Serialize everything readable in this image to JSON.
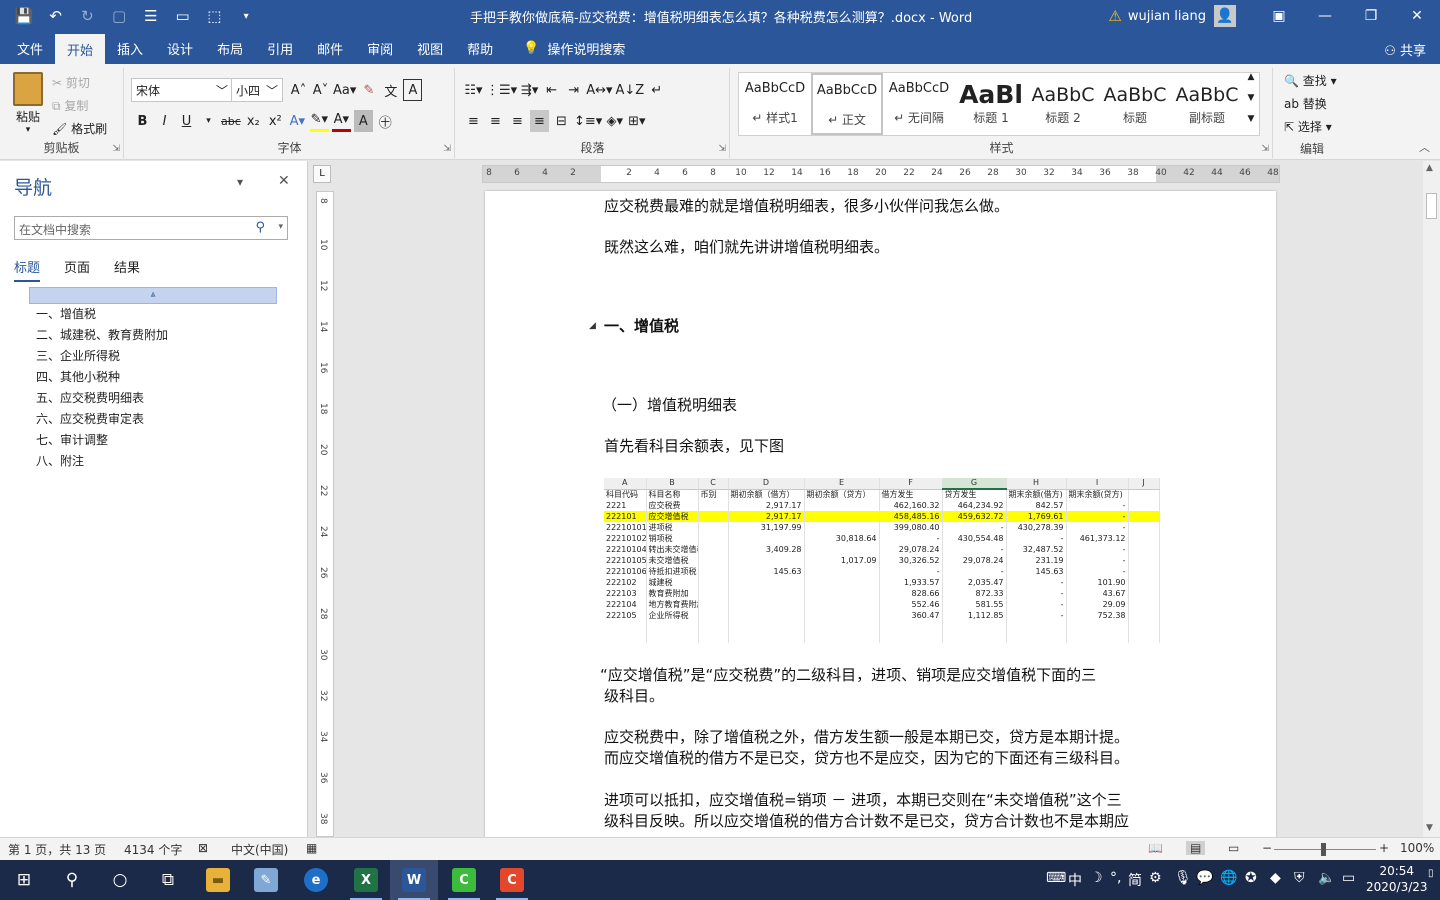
{
  "titlebar": {
    "document_title": "手把手教你做底稿-应交税费：增值税明细表怎么填？各种税费怎么测算？.docx  -  Word",
    "user_name": "wujian liang"
  },
  "tabs": [
    "文件",
    "开始",
    "插入",
    "设计",
    "布局",
    "引用",
    "邮件",
    "审阅",
    "视图",
    "帮助"
  ],
  "active_tab": "开始",
  "tell_me": "操作说明搜索",
  "share": "共享",
  "ribbon": {
    "clipboard": {
      "paste": "粘贴",
      "cut": "剪切",
      "copy": "复制",
      "format_painter": "格式刷",
      "label": "剪贴板"
    },
    "font": {
      "name": "宋体",
      "size": "小四",
      "label": "字体"
    },
    "paragraph": {
      "label": "段落"
    },
    "styles": {
      "label": "样式",
      "items": [
        {
          "preview": "AaBbCcD",
          "name": "↵ 样式1"
        },
        {
          "preview": "AaBbCcD",
          "name": "↵ 正文"
        },
        {
          "preview": "AaBbCcD",
          "name": "↵ 无间隔"
        },
        {
          "preview": "AaBl",
          "name": "标题 1"
        },
        {
          "preview": "AaBbC",
          "name": "标题 2"
        },
        {
          "preview": "AaBbC",
          "name": "标题"
        },
        {
          "preview": "AaBbC",
          "name": "副标题"
        }
      ]
    },
    "editing": {
      "find": "查找",
      "replace": "替换",
      "select": "选择",
      "label": "编辑"
    }
  },
  "nav": {
    "title": "导航",
    "search_placeholder": "在文档中搜索",
    "tabs": [
      "标题",
      "页面",
      "结果"
    ],
    "headings": [
      "一、增值税",
      "二、城建税、教育费附加",
      "三、企业所得税",
      "四、其他小税种",
      "五、应交税费明细表",
      "六、应交税费审定表",
      "七、审计调整",
      "八、附注"
    ]
  },
  "ruler": {
    "h_ticks": [
      "8",
      "6",
      "4",
      "2",
      "",
      "2",
      "4",
      "6",
      "8",
      "10",
      "12",
      "14",
      "16",
      "18",
      "20",
      "22",
      "24",
      "26",
      "28",
      "30",
      "32",
      "34",
      "36",
      "38",
      "40",
      "42",
      "44",
      "46",
      "48"
    ],
    "v_ticks": [
      "8",
      "10",
      "12",
      "14",
      "16",
      "18",
      "20",
      "22",
      "24",
      "26",
      "28",
      "30",
      "32",
      "34",
      "36",
      "38"
    ]
  },
  "doc": {
    "p1": "应交税费最难的就是增值税明细表，很多小伙伴问我怎么做。",
    "p2": "既然这么难，咱们就先讲讲增值税明细表。",
    "h1": "一、增值税",
    "h2": "（一）增值税明细表",
    "p3": "首先看科目余额表，见下图",
    "p4a": "“应交增值税”是“应交税费”的二级科目，进项、销项是应交增值税下面的三",
    "p4b": "级科目。",
    "p5a": "应交税费中，除了增值税之外，借方发生额一般是本期已交，贷方是本期计提。",
    "p5b": "而应交增值税的借方不是已交，贷方也不是应交，因为它的下面还有三级科目。",
    "p6a": "进项可以抵扣，应交增值税=销项 － 进项，本期已交则在“未交增值税”这个三",
    "p6b": "级科目反映。所以应交增值税的借方合计数不是已交，贷方合计数也不是本期应"
  },
  "sheet": {
    "col_letters": [
      "A",
      "B",
      "C",
      "D",
      "E",
      "F",
      "G",
      "H",
      "I",
      "J"
    ],
    "headers": [
      "科目代码",
      "科目名称",
      "币别",
      "期初余额（借方）",
      "期初余额（贷方）",
      "借方发生",
      "贷方发生",
      "期末余额(借方)",
      "期末余额(贷方)",
      ""
    ],
    "rows": [
      [
        "2221",
        "应交税费",
        "",
        "2,917.17",
        "",
        "462,160.32",
        "464,234.92",
        "842.57",
        "-",
        ""
      ],
      [
        "222101",
        "应交增值税",
        "",
        "2,917.17",
        "",
        "458,485.16",
        "459,632.72",
        "1,769.61",
        "-",
        ""
      ],
      [
        "22210101",
        "进项税",
        "",
        "31,197.99",
        "",
        "399,080.40",
        "-",
        "430,278.39",
        "-",
        ""
      ],
      [
        "22210102",
        "销项税",
        "",
        "",
        "30,818.64",
        "-",
        "430,554.48",
        "-",
        "461,373.12",
        ""
      ],
      [
        "22210104",
        "转出未交增值税",
        "",
        "3,409.28",
        "",
        "29,078.24",
        "-",
        "32,487.52",
        "-",
        ""
      ],
      [
        "22210105",
        "未交增值税",
        "",
        "",
        "1,017.09",
        "30,326.52",
        "29,078.24",
        "231.19",
        "-",
        ""
      ],
      [
        "22210106",
        "待抵扣进项税",
        "",
        "145.63",
        "",
        "-",
        "-",
        "145.63",
        "-",
        ""
      ],
      [
        "222102",
        "城建税",
        "",
        "",
        "",
        "1,933.57",
        "2,035.47",
        "-",
        "101.90",
        ""
      ],
      [
        "222103",
        "教育费附加",
        "",
        "",
        "",
        "828.66",
        "872.33",
        "-",
        "43.67",
        ""
      ],
      [
        "222104",
        "地方教育费附加",
        "",
        "",
        "",
        "552.46",
        "581.55",
        "-",
        "29.09",
        ""
      ],
      [
        "222105",
        "企业所得税",
        "",
        "",
        "",
        "360.47",
        "1,112.85",
        "-",
        "752.38",
        ""
      ],
      [
        "",
        "",
        "",
        "",
        "",
        "",
        "",
        "",
        "",
        ""
      ],
      [
        "",
        "",
        "",
        "",
        "",
        "",
        "",
        "",
        "",
        ""
      ]
    ]
  },
  "status": {
    "page": "第 1 页，共 13 页",
    "words": "4134 个字",
    "language": "中文(中国)",
    "zoom": "100%"
  },
  "taskbar": {
    "time": "20:54",
    "date": "2020/3/23",
    "ime": [
      "中",
      "简"
    ]
  },
  "colors": {
    "word_blue": "#2b579a",
    "highlight": "#ffff00",
    "taskbar": "#1c2a4a"
  }
}
